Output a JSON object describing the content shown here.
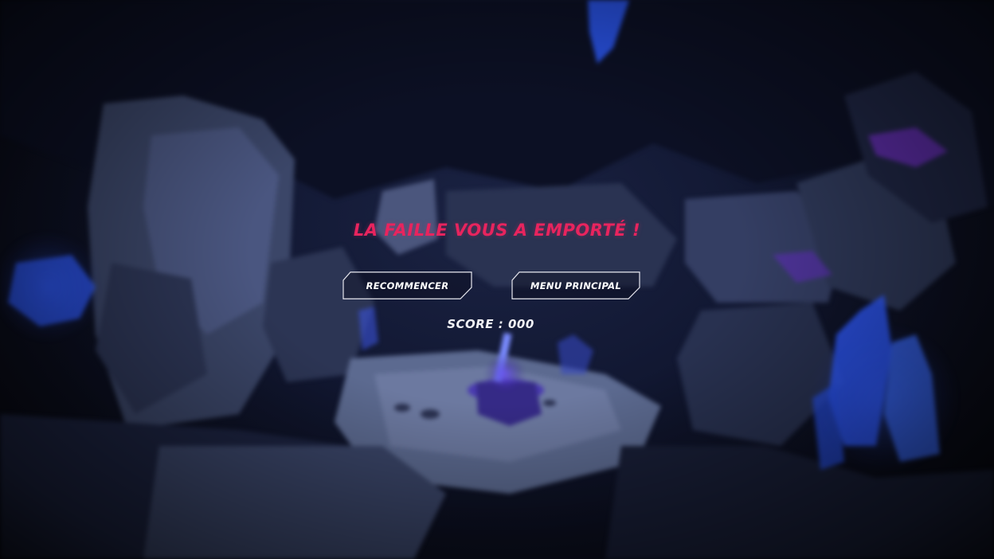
{
  "game_over": {
    "title": "LA FAILLE VOUS A EMPORTÉ !",
    "restart_label": "RECOMMENCER",
    "main_menu_label": "MENU PRINCIPAL",
    "score_text": "SCORE : 000"
  },
  "colors": {
    "title": "#e8245e",
    "button_text": "#ffffff",
    "button_border": "#e6e6ee",
    "crystal_glow": "#2f5bff",
    "background": "#111731"
  }
}
